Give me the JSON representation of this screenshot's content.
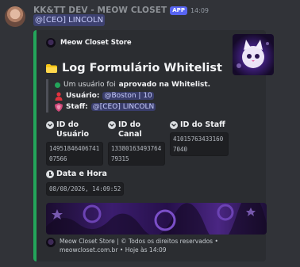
{
  "message": {
    "username": "KK&TT DEV - MEOW CLOSET",
    "app_badge": "APP",
    "timestamp": "14:09",
    "mention": "@[CEO] LINCOLN"
  },
  "embed": {
    "accent_color": "#23a55a",
    "author": "Meow Closet Store",
    "title": "Log Formulário Whitelist",
    "description": {
      "line1_prefix": "Um usuário foi",
      "line1_bold": "aprovado na Whitelist.",
      "usuario_label": "Usuário:",
      "usuario_value": "@Boston | 10",
      "staff_label": "Staff:",
      "staff_value": "@[CEO] LINCOLN"
    },
    "fields": [
      {
        "name": "ID do Usuário",
        "value": "1495184640674107566"
      },
      {
        "name": "ID do Canal",
        "value": "1338016349376479315"
      },
      {
        "name": "ID do Staff",
        "value": "410157634331607040"
      }
    ],
    "date_field": {
      "name": "Data e Hora",
      "value": "08/08/2026, 14:09:52"
    },
    "footer": {
      "line1": "Meow Closet Store | © Todos os direitos reservados •",
      "line2": "meowcloset.com.br • Hoje às 14:09"
    }
  },
  "icons": [
    "user-avatar",
    "folder-icon",
    "green-dot-icon",
    "user-red-icon",
    "shield-pink-icon",
    "chevron-circle-icon",
    "clock-icon",
    "store-logo-icon"
  ],
  "colors": {
    "background": "#313338",
    "embed_bg": "#2b2d31",
    "accent": "#23a55a",
    "mention": "#5865f2"
  }
}
